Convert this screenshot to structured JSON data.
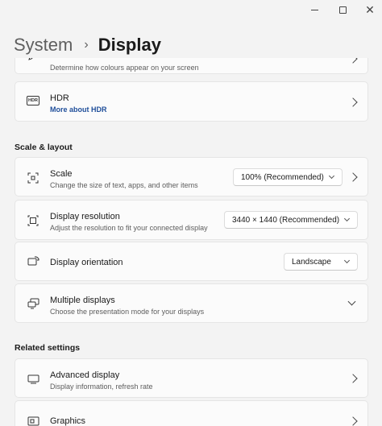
{
  "window": {
    "minimize_icon": "minimize-icon",
    "maximize_icon": "maximize-icon",
    "close_icon": "close-icon",
    "close_glyph": "✕"
  },
  "breadcrumb": {
    "parent": "System",
    "separator": "›",
    "current": "Display"
  },
  "cards_top": [
    {
      "icon": "pen-icon",
      "title": "",
      "desc": "Determine how colours appear on your screen"
    },
    {
      "icon": "hdr-icon",
      "icon_text": "HDR",
      "title": "HDR",
      "link": "More about HDR"
    }
  ],
  "sections": {
    "scale_layout": "Scale & layout",
    "related": "Related settings"
  },
  "scale": {
    "icon": "scale-icon",
    "title": "Scale",
    "desc": "Change the size of text, apps, and other items",
    "value": "100% (Recommended)"
  },
  "resolution": {
    "icon": "resolution-icon",
    "title": "Display resolution",
    "desc": "Adjust the resolution to fit your connected display",
    "value": "3440 × 1440 (Recommended)"
  },
  "orientation": {
    "icon": "orientation-icon",
    "title": "Display orientation",
    "value": "Landscape"
  },
  "multiple": {
    "icon": "multiple-displays-icon",
    "title": "Multiple displays",
    "desc": "Choose the presentation mode for your displays"
  },
  "advanced": {
    "icon": "monitor-icon",
    "title": "Advanced display",
    "desc": "Display information, refresh rate"
  },
  "graphics": {
    "icon": "graphics-icon",
    "title": "Graphics"
  }
}
